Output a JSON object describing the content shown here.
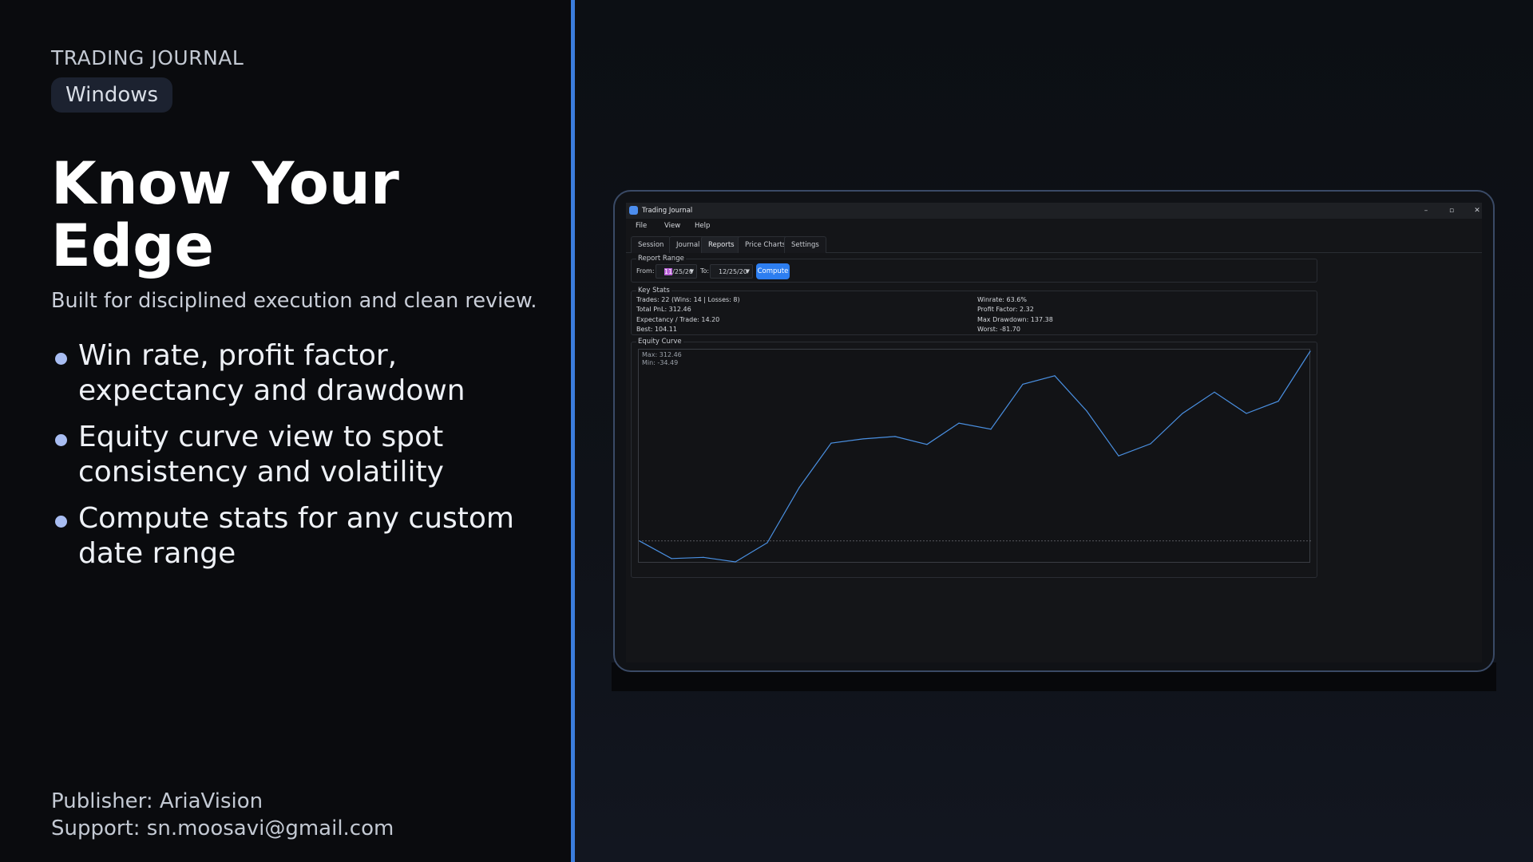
{
  "promo": {
    "eyebrow": "TRADING JOURNAL",
    "platform_badge": "Windows",
    "headline": "Know Your Edge",
    "subheadline": "Built for disciplined execution and clean review.",
    "features": [
      "Win rate, profit factor, expectancy and drawdown",
      "Equity curve view to spot consistency and volatility",
      "Compute stats for any custom date range"
    ],
    "publisher": "Publisher: AriaVision",
    "support": "Support: sn.moosavi@gmail.com"
  },
  "app": {
    "title": "Trading Journal",
    "window_controls": [
      "–",
      "▫",
      "✕"
    ],
    "menu": [
      "File",
      "View",
      "Help"
    ],
    "tabs": [
      "Session",
      "Journal",
      "Reports",
      "Price Charts",
      "Settings"
    ],
    "active_tab": "Reports",
    "report_range": {
      "label": "Report Range",
      "from_label": "From:",
      "from_value_selected": "11",
      "from_value_rest": "/25/20",
      "to_label": "To:",
      "to_value": "12/25/20",
      "compute_label": "Compute"
    },
    "key_stats": {
      "label": "Key Stats",
      "left": [
        "Trades: 22 (Wins: 14 | Losses: 8)",
        "Total PnL: 312.46",
        "Expectancy / Trade: 14.20",
        "Best: 104.11"
      ],
      "right": [
        "Winrate: 63.6%",
        "Profit Factor: 2.32",
        "Max Drawdown: 137.38",
        "Worst: -81.70"
      ]
    },
    "equity_curve": {
      "label": "Equity Curve",
      "max_label": "Max: 312.46",
      "min_label": "Min: -34.49"
    }
  },
  "colors": {
    "accent": "#3b7ddd",
    "line": "#4a90e2",
    "button": "#2d7ef0"
  },
  "chart_data": {
    "type": "line",
    "title": "Equity Curve",
    "x": [
      0,
      1,
      2,
      3,
      4,
      5,
      6,
      7,
      8,
      9,
      10,
      11,
      12,
      13,
      14,
      15,
      16,
      17,
      18,
      19,
      20,
      21
    ],
    "series": [
      {
        "values": [
          0,
          -29,
          -27,
          -34.49,
          -3,
          88,
          161,
          168,
          172,
          159,
          194,
          184,
          258,
          272,
          214,
          140,
          160,
          210,
          245,
          210,
          230,
          312.46
        ]
      }
    ],
    "ylim": [
      -34.49,
      312.46
    ],
    "baseline": 0,
    "max": 312.46,
    "min": -34.49,
    "grid": false
  }
}
